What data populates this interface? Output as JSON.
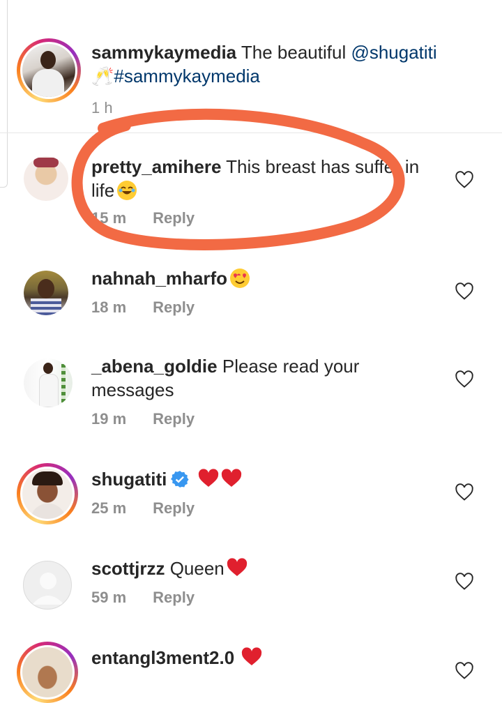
{
  "caption": {
    "username": "sammykaymedia",
    "text_before": " The beautiful ",
    "mention": "@shugatiti",
    "emoji": "🥂",
    "hashtag": "#sammykaymedia",
    "time": "1 h"
  },
  "comments": [
    {
      "username": "pretty_amihere",
      "text": " This breast has suffer in life",
      "emoji": "😂",
      "time": "15 m",
      "reply": "Reply"
    },
    {
      "username": "nahnah_mharfo",
      "text": "",
      "emoji": "😍",
      "time": "18 m",
      "reply": "Reply"
    },
    {
      "username": "_abena_goldie",
      "text": " Please read your messages",
      "time": "19 m",
      "reply": "Reply"
    },
    {
      "username": "shugatiti",
      "text": "",
      "emoji": "❤❤",
      "verified": true,
      "time": "25 m",
      "reply": "Reply"
    },
    {
      "username": "scottjrzz",
      "text": " Queen",
      "emoji": "❤",
      "time": "59 m",
      "reply": "Reply"
    },
    {
      "username": "entangl3ment2.0",
      "text": " ",
      "emoji": "❤",
      "time": "",
      "reply": ""
    }
  ],
  "colors": {
    "username": "#262626",
    "link": "#00376b",
    "meta": "#8e8e8e",
    "annotation_stroke": "#f26a44",
    "verified_badge": "#3897f0"
  }
}
